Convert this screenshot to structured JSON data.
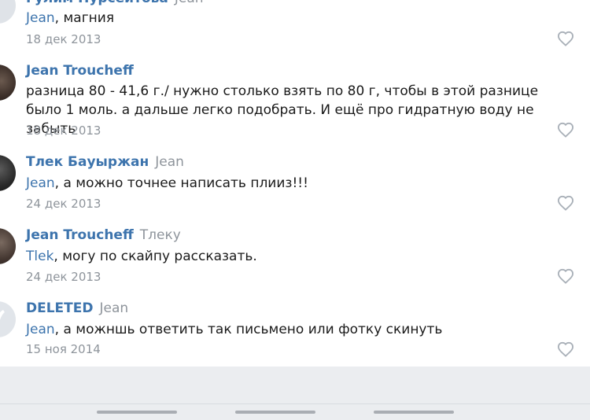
{
  "comments": [
    {
      "author": "Гулим Нурсеитова",
      "reply_to": "Jean",
      "mention": "Jean",
      "text": ", магния",
      "date": "18 дек 2013",
      "avatar": "avatar-placeholder"
    },
    {
      "author": "Jean Troucheff",
      "reply_to": "",
      "mention": "",
      "text": "разница 80 - 41,6 г./ нужно столько взять по 80 г, чтобы в этой разнице было 1 моль. а дальше легко подобрать. И ещё про гидратную воду не забыть",
      "date": "18 дек 2013",
      "avatar": "user-photo"
    },
    {
      "author": "Тлек Бауыржан",
      "reply_to": "Jean",
      "mention": "Jean",
      "text": ", а можно точнее написать плииз!!!",
      "date": "24 дек 2013",
      "avatar": "user-photo"
    },
    {
      "author": "Jean Troucheff",
      "reply_to": "Тлеку",
      "mention": "Tlek",
      "text": ", могу по скайпу рассказать.",
      "date": "24 дек 2013",
      "avatar": "user-photo"
    },
    {
      "author": "DELETED",
      "reply_to": "Jean",
      "mention": "Jean",
      "text": ", а можншь ответить так письмено или фотку скинуть",
      "date": "15 ноя 2014",
      "avatar": "deleted-user-avatar"
    }
  ],
  "icons": {
    "like": "heart-outline-icon",
    "nav_handles": [
      "handle-left",
      "handle-center",
      "handle-right"
    ]
  },
  "colors": {
    "link": "#3d74ad",
    "secondary_text": "#8e949b",
    "like_icon": "#a9b0b8",
    "footer_bg": "#ebedf0"
  }
}
